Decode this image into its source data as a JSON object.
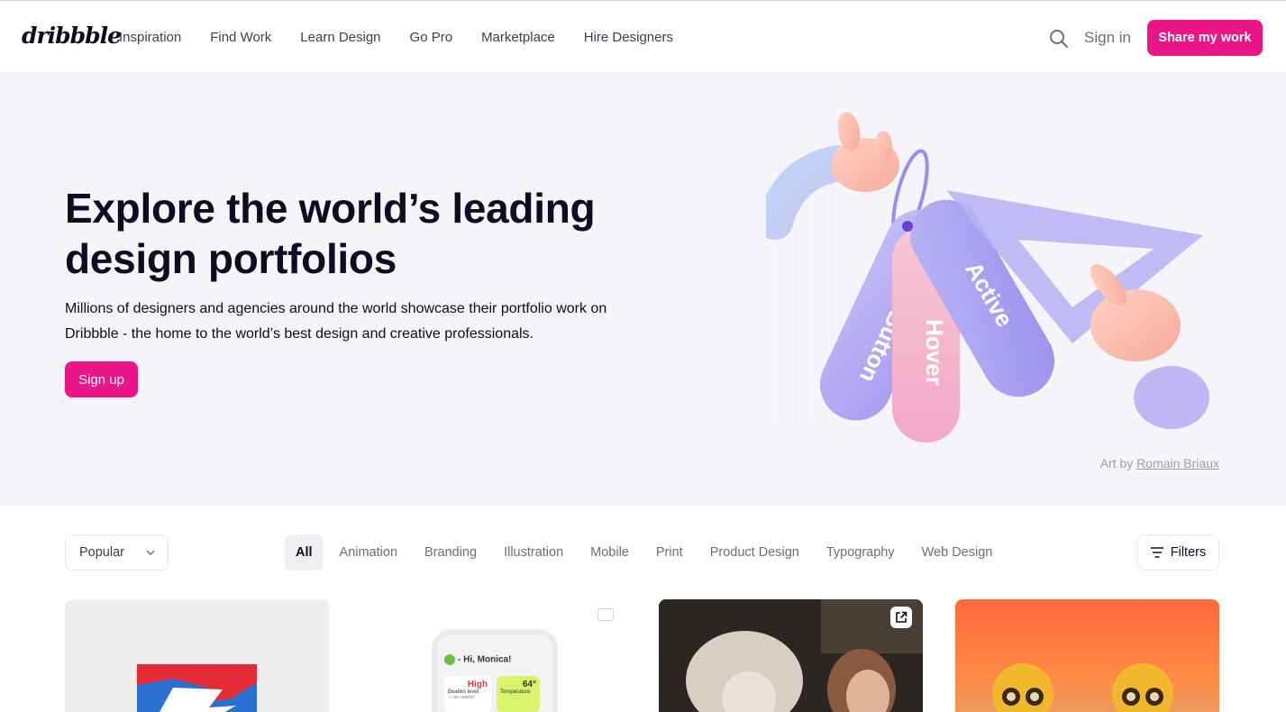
{
  "header": {
    "logo": "dribbble",
    "nav": [
      "Inspiration",
      "Find Work",
      "Learn Design",
      "Go Pro",
      "Marketplace",
      "Hire Designers"
    ],
    "sign_in": "Sign in",
    "share_button": "Share my work"
  },
  "hero": {
    "title": "Explore the world’s leading design portfolios",
    "subtitle": "Millions of designers and agencies around the world showcase their portfolio work on Dribbble - the home to the world’s best design and creative professionals.",
    "signup_button": "Sign up",
    "art_tags": [
      "Button",
      "Hover",
      "Active"
    ],
    "art_credit_prefix": "Art by",
    "art_credit_author": "Romain Briaux"
  },
  "filters": {
    "sort_selected": "Popular",
    "categories": [
      "All",
      "Animation",
      "Branding",
      "Illustration",
      "Mobile",
      "Print",
      "Product Design",
      "Typography",
      "Web Design"
    ],
    "active_category": "All",
    "filters_button": "Filters"
  },
  "shots": {
    "shot2_text": {
      "greeting": "- Hi, Monica!",
      "level": "High",
      "level_label": "Beatles level",
      "level_note": "— be careful!",
      "temp": "64°",
      "temp_label": "Temperature"
    }
  },
  "colors": {
    "accent": "#ea1587",
    "hero_bg": "#f5f4f9",
    "text_dark": "#0d0c22",
    "text_muted": "#6e6d7a"
  }
}
